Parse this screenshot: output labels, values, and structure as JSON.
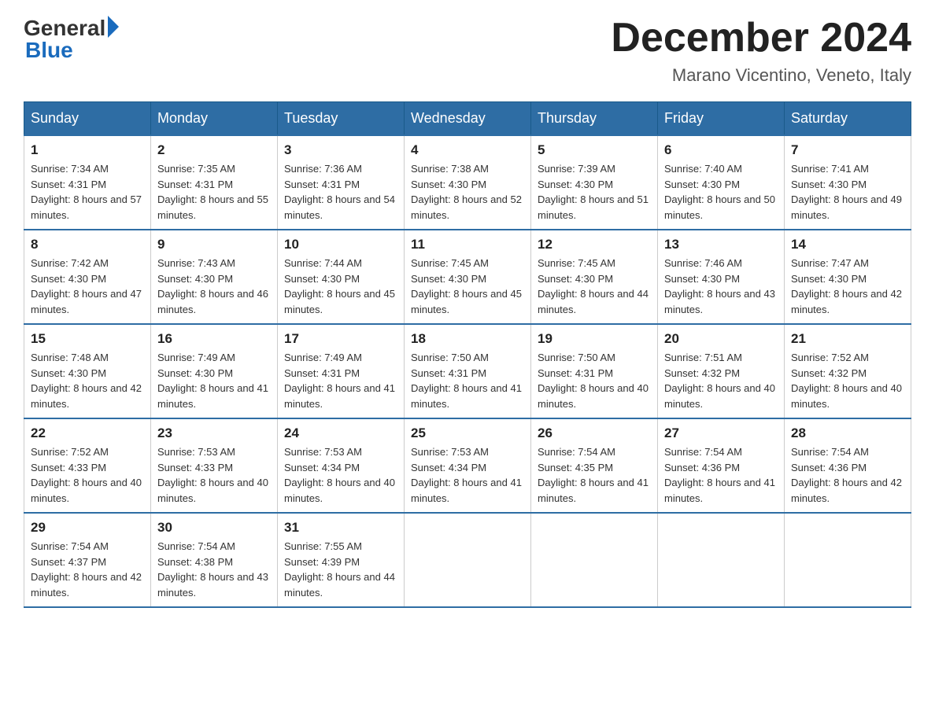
{
  "logo": {
    "general": "General",
    "blue": "Blue"
  },
  "header": {
    "title": "December 2024",
    "subtitle": "Marano Vicentino, Veneto, Italy"
  },
  "days_of_week": [
    "Sunday",
    "Monday",
    "Tuesday",
    "Wednesday",
    "Thursday",
    "Friday",
    "Saturday"
  ],
  "weeks": [
    [
      {
        "day": "1",
        "sunrise": "7:34 AM",
        "sunset": "4:31 PM",
        "daylight": "8 hours and 57 minutes."
      },
      {
        "day": "2",
        "sunrise": "7:35 AM",
        "sunset": "4:31 PM",
        "daylight": "8 hours and 55 minutes."
      },
      {
        "day": "3",
        "sunrise": "7:36 AM",
        "sunset": "4:31 PM",
        "daylight": "8 hours and 54 minutes."
      },
      {
        "day": "4",
        "sunrise": "7:38 AM",
        "sunset": "4:30 PM",
        "daylight": "8 hours and 52 minutes."
      },
      {
        "day": "5",
        "sunrise": "7:39 AM",
        "sunset": "4:30 PM",
        "daylight": "8 hours and 51 minutes."
      },
      {
        "day": "6",
        "sunrise": "7:40 AM",
        "sunset": "4:30 PM",
        "daylight": "8 hours and 50 minutes."
      },
      {
        "day": "7",
        "sunrise": "7:41 AM",
        "sunset": "4:30 PM",
        "daylight": "8 hours and 49 minutes."
      }
    ],
    [
      {
        "day": "8",
        "sunrise": "7:42 AM",
        "sunset": "4:30 PM",
        "daylight": "8 hours and 47 minutes."
      },
      {
        "day": "9",
        "sunrise": "7:43 AM",
        "sunset": "4:30 PM",
        "daylight": "8 hours and 46 minutes."
      },
      {
        "day": "10",
        "sunrise": "7:44 AM",
        "sunset": "4:30 PM",
        "daylight": "8 hours and 45 minutes."
      },
      {
        "day": "11",
        "sunrise": "7:45 AM",
        "sunset": "4:30 PM",
        "daylight": "8 hours and 45 minutes."
      },
      {
        "day": "12",
        "sunrise": "7:45 AM",
        "sunset": "4:30 PM",
        "daylight": "8 hours and 44 minutes."
      },
      {
        "day": "13",
        "sunrise": "7:46 AM",
        "sunset": "4:30 PM",
        "daylight": "8 hours and 43 minutes."
      },
      {
        "day": "14",
        "sunrise": "7:47 AM",
        "sunset": "4:30 PM",
        "daylight": "8 hours and 42 minutes."
      }
    ],
    [
      {
        "day": "15",
        "sunrise": "7:48 AM",
        "sunset": "4:30 PM",
        "daylight": "8 hours and 42 minutes."
      },
      {
        "day": "16",
        "sunrise": "7:49 AM",
        "sunset": "4:30 PM",
        "daylight": "8 hours and 41 minutes."
      },
      {
        "day": "17",
        "sunrise": "7:49 AM",
        "sunset": "4:31 PM",
        "daylight": "8 hours and 41 minutes."
      },
      {
        "day": "18",
        "sunrise": "7:50 AM",
        "sunset": "4:31 PM",
        "daylight": "8 hours and 41 minutes."
      },
      {
        "day": "19",
        "sunrise": "7:50 AM",
        "sunset": "4:31 PM",
        "daylight": "8 hours and 40 minutes."
      },
      {
        "day": "20",
        "sunrise": "7:51 AM",
        "sunset": "4:32 PM",
        "daylight": "8 hours and 40 minutes."
      },
      {
        "day": "21",
        "sunrise": "7:52 AM",
        "sunset": "4:32 PM",
        "daylight": "8 hours and 40 minutes."
      }
    ],
    [
      {
        "day": "22",
        "sunrise": "7:52 AM",
        "sunset": "4:33 PM",
        "daylight": "8 hours and 40 minutes."
      },
      {
        "day": "23",
        "sunrise": "7:53 AM",
        "sunset": "4:33 PM",
        "daylight": "8 hours and 40 minutes."
      },
      {
        "day": "24",
        "sunrise": "7:53 AM",
        "sunset": "4:34 PM",
        "daylight": "8 hours and 40 minutes."
      },
      {
        "day": "25",
        "sunrise": "7:53 AM",
        "sunset": "4:34 PM",
        "daylight": "8 hours and 41 minutes."
      },
      {
        "day": "26",
        "sunrise": "7:54 AM",
        "sunset": "4:35 PM",
        "daylight": "8 hours and 41 minutes."
      },
      {
        "day": "27",
        "sunrise": "7:54 AM",
        "sunset": "4:36 PM",
        "daylight": "8 hours and 41 minutes."
      },
      {
        "day": "28",
        "sunrise": "7:54 AM",
        "sunset": "4:36 PM",
        "daylight": "8 hours and 42 minutes."
      }
    ],
    [
      {
        "day": "29",
        "sunrise": "7:54 AM",
        "sunset": "4:37 PM",
        "daylight": "8 hours and 42 minutes."
      },
      {
        "day": "30",
        "sunrise": "7:54 AM",
        "sunset": "4:38 PM",
        "daylight": "8 hours and 43 minutes."
      },
      {
        "day": "31",
        "sunrise": "7:55 AM",
        "sunset": "4:39 PM",
        "daylight": "8 hours and 44 minutes."
      },
      null,
      null,
      null,
      null
    ]
  ]
}
